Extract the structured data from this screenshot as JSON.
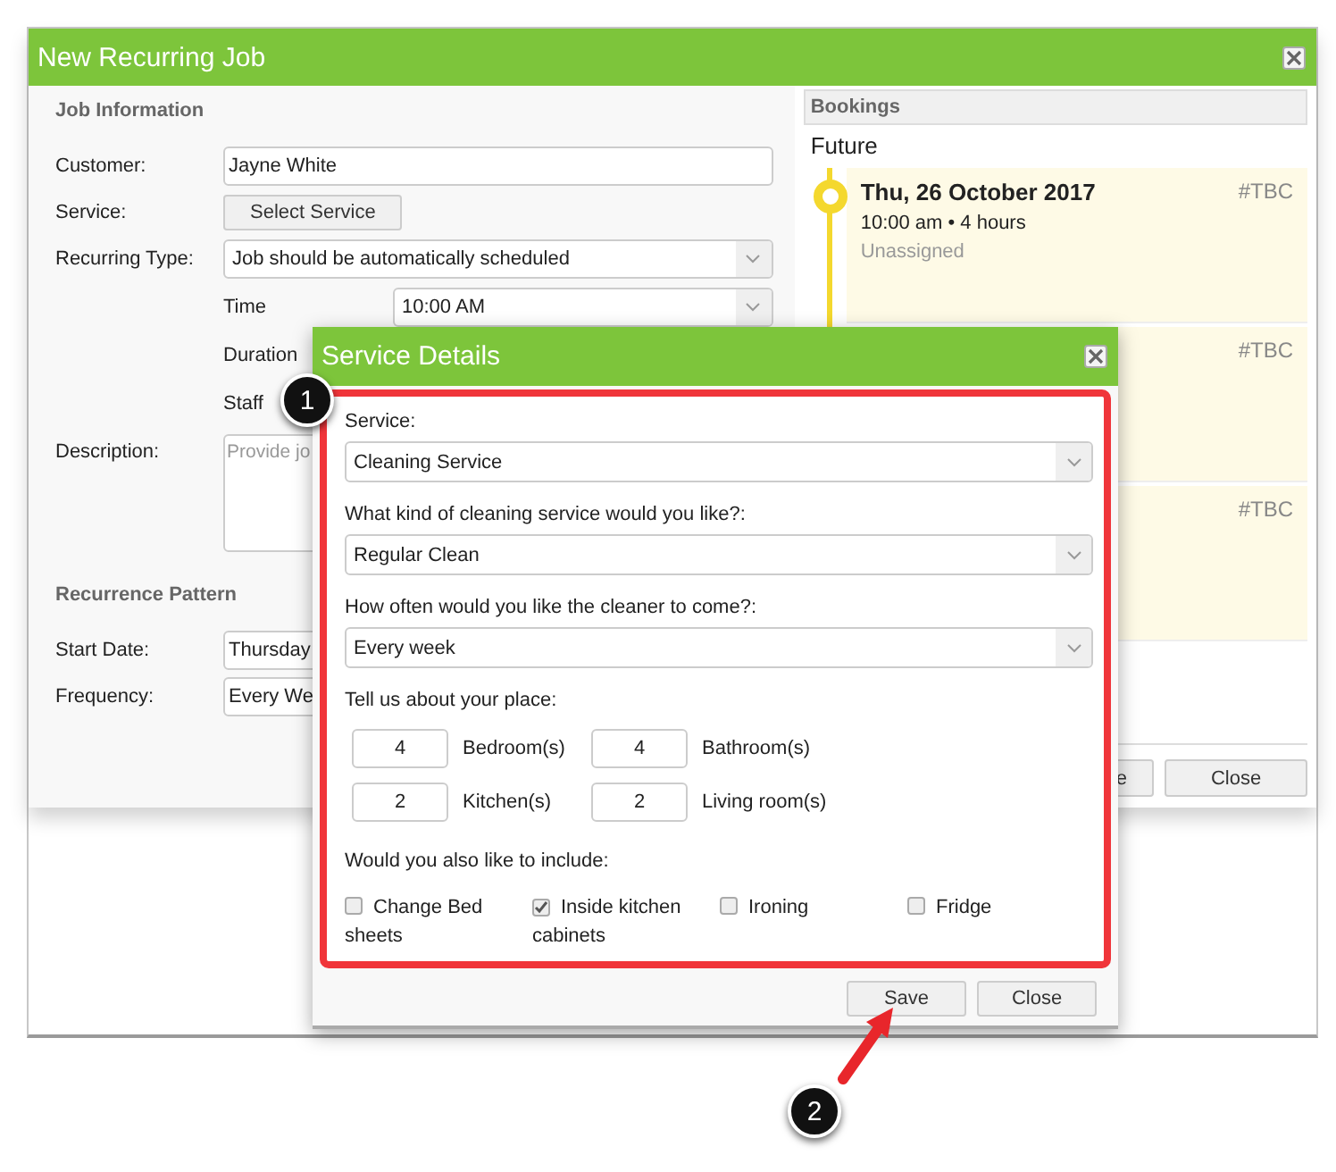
{
  "main_window": {
    "title": "New Recurring Job"
  },
  "job_information": {
    "heading": "Job Information",
    "fields": [
      {
        "kind": "input",
        "label": "Customer:",
        "value": "Jayne White"
      },
      {
        "kind": "button",
        "label": "Service:",
        "value": "Select Service"
      },
      {
        "kind": "select",
        "label": "Recurring Type:",
        "value": "Job should be automatically scheduled"
      }
    ],
    "sub_fields": [
      {
        "kind": "select",
        "label": "Time",
        "value": "10:00 AM"
      },
      {
        "kind": "label",
        "label": "Duration"
      },
      {
        "kind": "label",
        "label": "Staff"
      }
    ],
    "description": {
      "label": "Description:",
      "placeholder": "Provide jo"
    }
  },
  "recurrence_pattern": {
    "heading": "Recurrence Pattern",
    "fields": [
      {
        "label": "Start Date:",
        "value": "Thursday"
      },
      {
        "label": "Frequency:",
        "value": "Every We"
      }
    ]
  },
  "bookings": {
    "heading": "Bookings",
    "group": "Future",
    "items": [
      {
        "date": "Thu, 26 October 2017",
        "time": "10:00 am • 4 hours",
        "staff": "Unassigned",
        "ref": "#TBC"
      },
      {
        "ref": "#TBC"
      },
      {
        "ref": "#TBC"
      }
    ]
  },
  "window_buttons": [
    "e",
    "Close"
  ],
  "service_details": {
    "title": "Service Details",
    "selects": [
      {
        "label": "Service:",
        "value": "Cleaning Service"
      },
      {
        "label": "What kind of cleaning service would you like?:",
        "value": "Regular Clean"
      },
      {
        "label": "How often would you like the cleaner to come?:",
        "value": "Every week"
      }
    ],
    "rooms_heading": "Tell us about your place:",
    "rooms": [
      {
        "value": "4",
        "label": "Bedroom(s)"
      },
      {
        "value": "4",
        "label": "Bathroom(s)"
      },
      {
        "value": "2",
        "label": "Kitchen(s)"
      },
      {
        "value": "2",
        "label": "Living room(s)"
      }
    ],
    "extras_heading": "Would you also like to include:",
    "extras": [
      {
        "label": "Change Bed sheets",
        "checked": false
      },
      {
        "label": "Inside kitchen cabinets",
        "checked": true
      },
      {
        "label": "Ironing",
        "checked": false
      },
      {
        "label": "Fridge",
        "checked": false
      }
    ],
    "buttons": [
      "Save",
      "Close"
    ]
  },
  "callouts": [
    "1",
    "2"
  ]
}
